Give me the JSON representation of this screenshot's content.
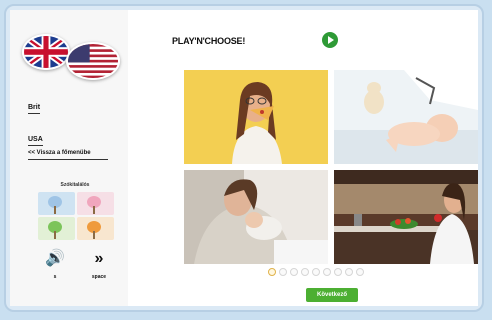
{
  "sidebar": {
    "flags": [
      {
        "icon": "uk-flag-icon"
      },
      {
        "icon": "us-flag-icon"
      }
    ],
    "nav_items": [
      {
        "label": "Brit"
      },
      {
        "label": "USA"
      }
    ],
    "back_link": "<< Vissza a főmenübe",
    "game_title": "Szókitalálós",
    "sound_label": "s",
    "next_label": "space"
  },
  "main": {
    "title": "PLAY'N'CHOOSE!",
    "next_button": "Következő",
    "dots_total": 9,
    "dots_active_index": 0
  },
  "colors": {
    "accent_green": "#2e9a36",
    "button_green": "#4caf32"
  }
}
